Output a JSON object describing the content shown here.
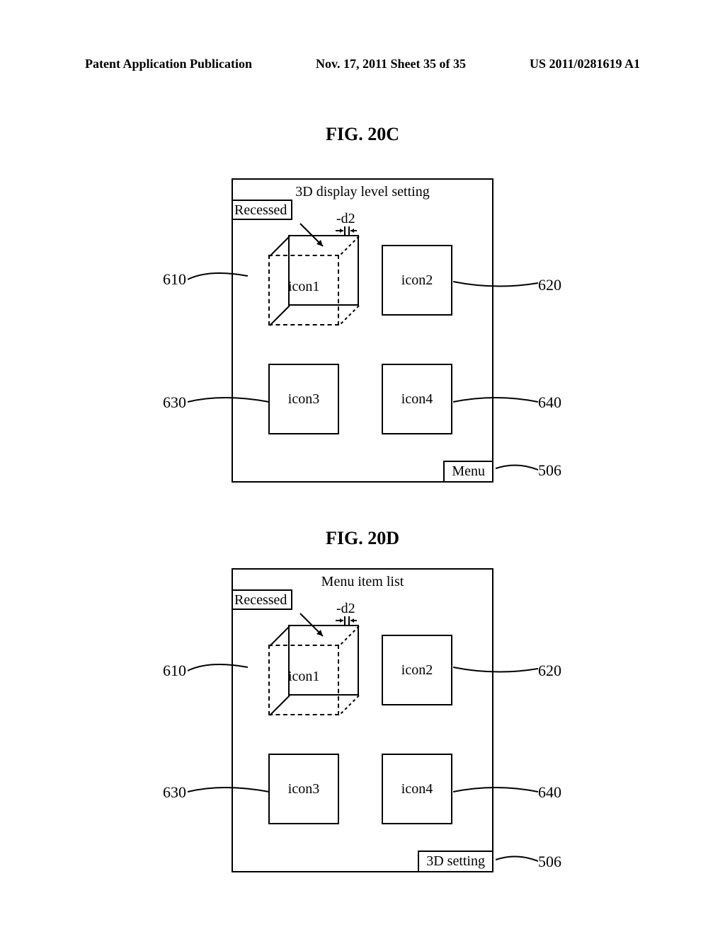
{
  "header": {
    "left": "Patent Application Publication",
    "center": "Nov. 17, 2011  Sheet 35 of 35",
    "right": "US 2011/0281619 A1"
  },
  "fig20c": {
    "label": "FIG. 20C",
    "title": "3D display level setting",
    "recessed": "Recessed",
    "d2": "-d2",
    "icon1": "icon1",
    "icon2": "icon2",
    "icon3": "icon3",
    "icon4": "icon4",
    "menu": "Menu",
    "ref610": "610",
    "ref620": "620",
    "ref630": "630",
    "ref640": "640",
    "ref506": "506"
  },
  "fig20d": {
    "label": "FIG. 20D",
    "title": "Menu item list",
    "recessed": "Recessed",
    "d2": "-d2",
    "icon1": "icon1",
    "icon2": "icon2",
    "icon3": "icon3",
    "icon4": "icon4",
    "menu": "3D setting",
    "ref610": "610",
    "ref620": "620",
    "ref630": "630",
    "ref640": "640",
    "ref506": "506"
  }
}
